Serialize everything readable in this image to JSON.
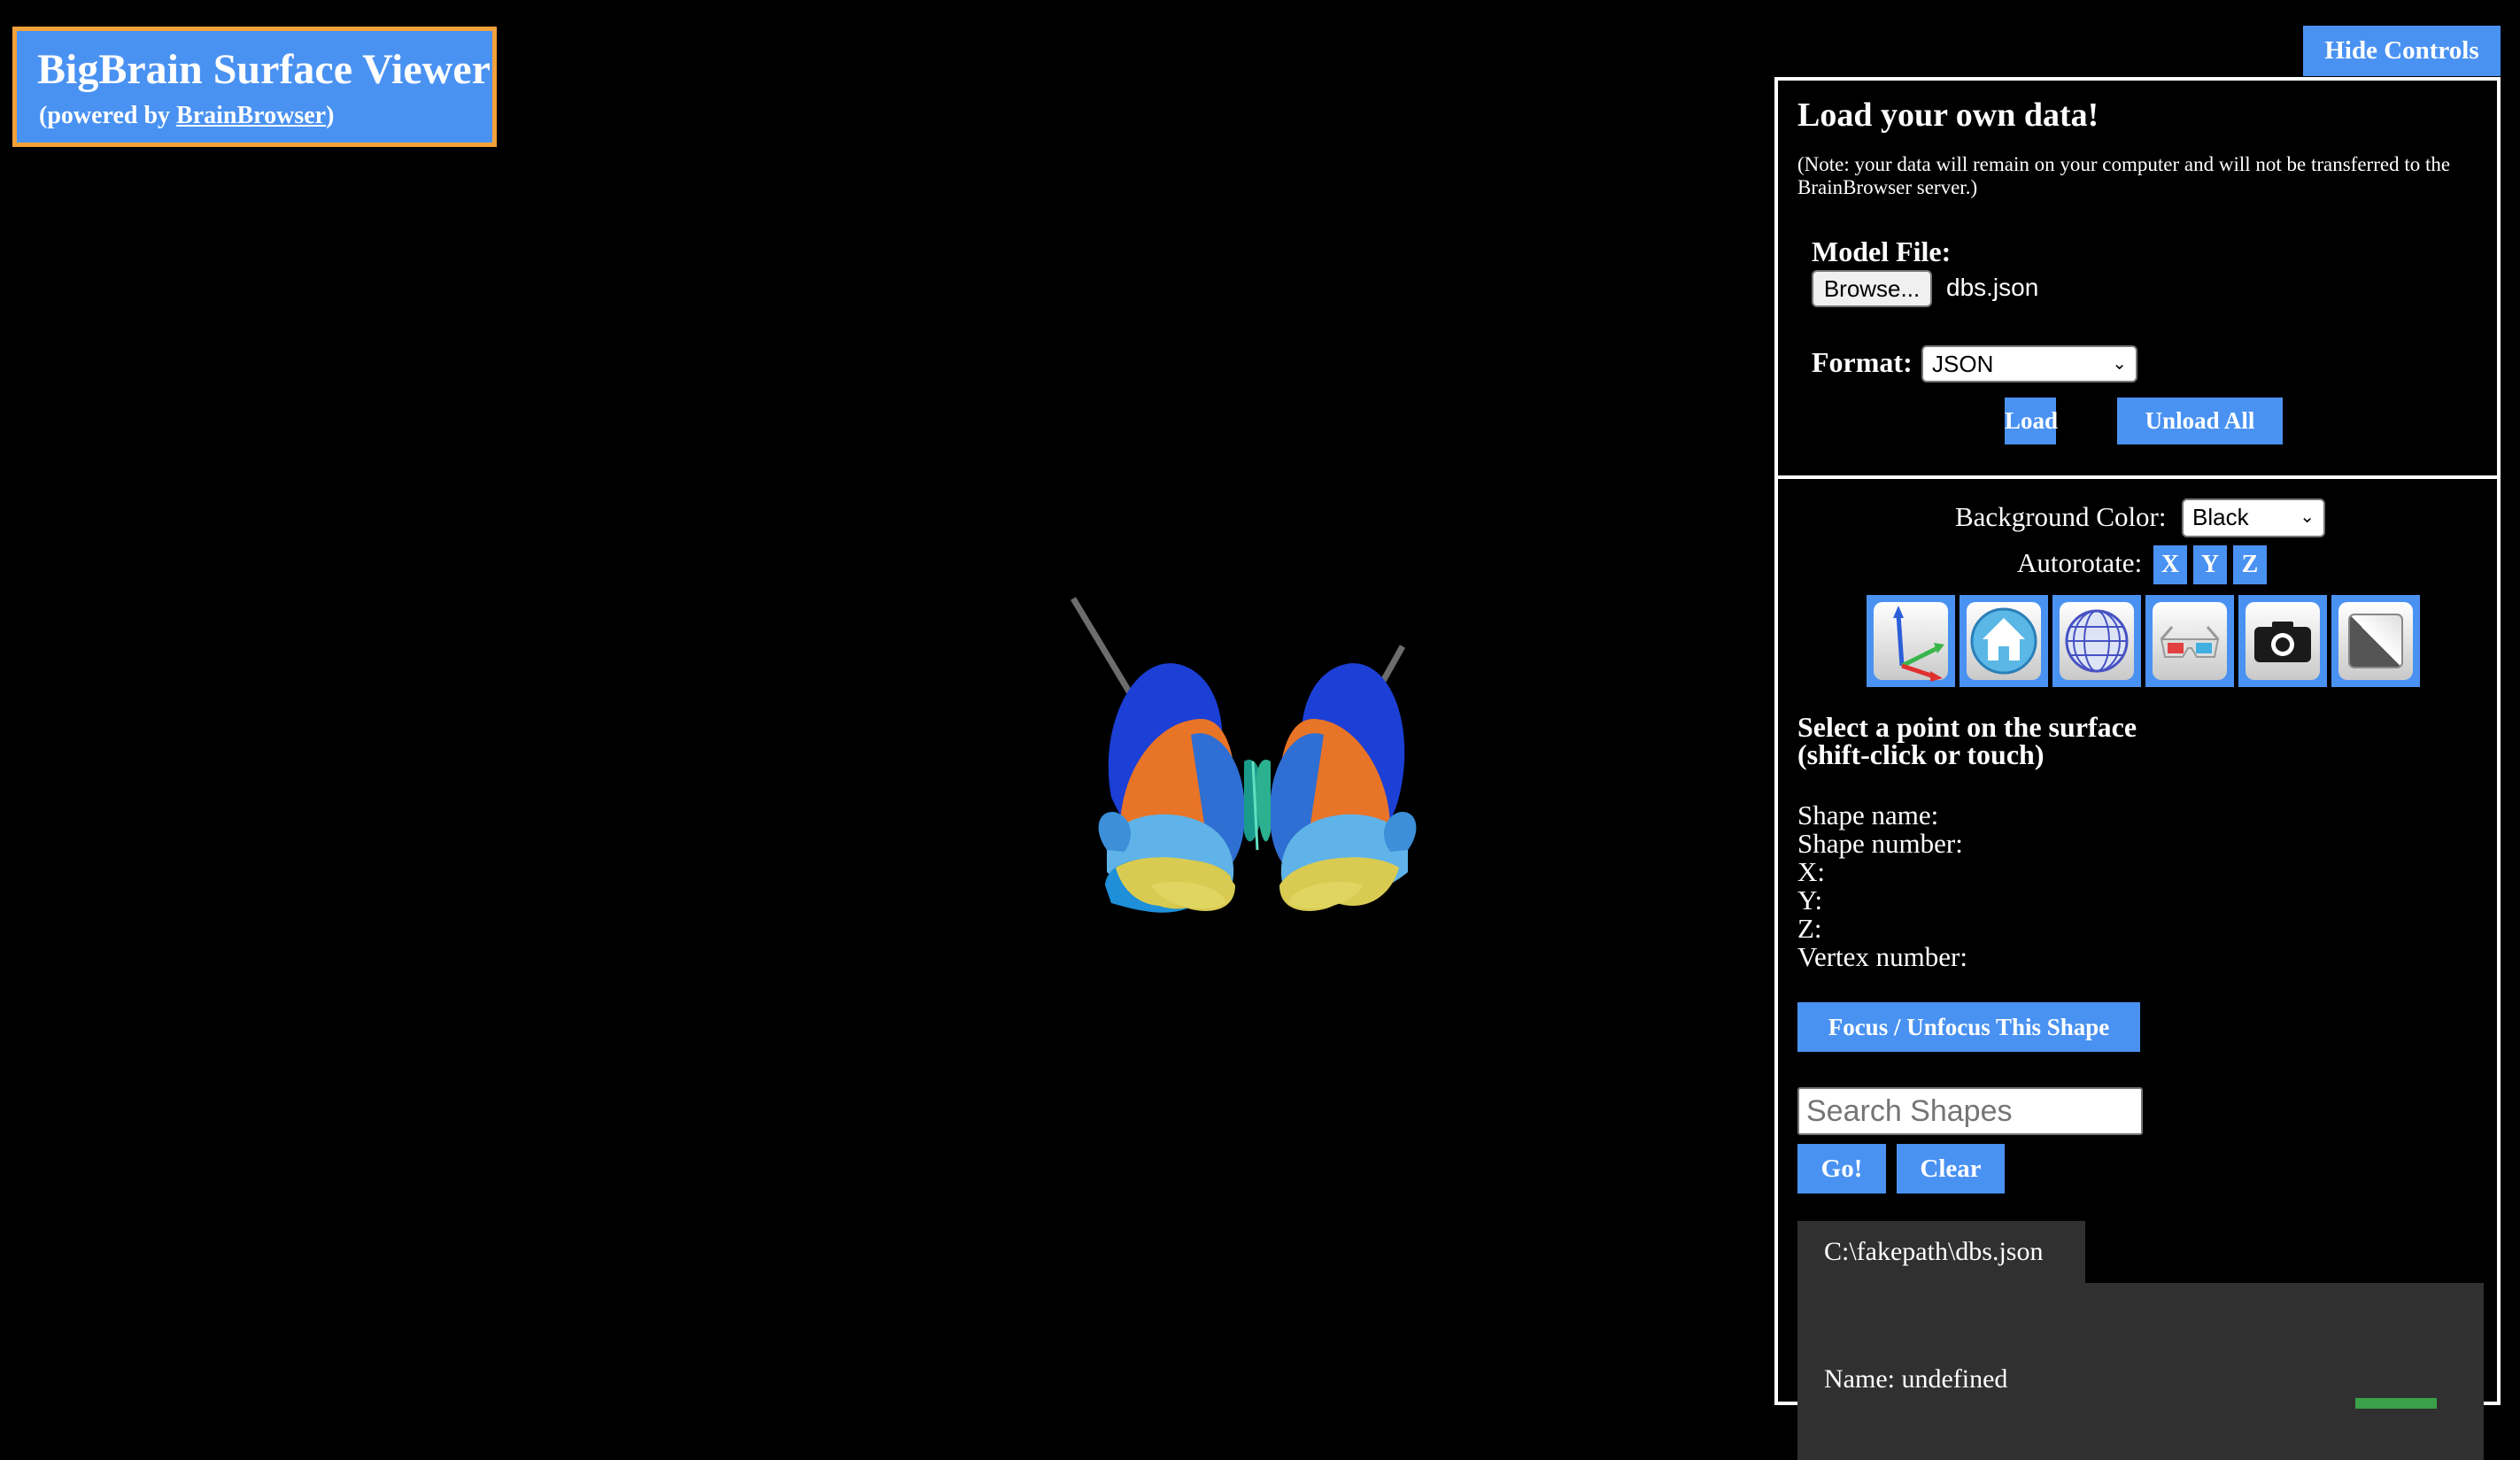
{
  "header": {
    "title": "BigBrain Surface Viewer",
    "powered_prefix": "(powered by ",
    "powered_link": "BrainBrowser",
    "powered_suffix": ")"
  },
  "hide_controls_label": "Hide Controls",
  "load_section": {
    "heading": "Load your own data!",
    "note": "(Note: your data will remain on your computer and will not be transferred to the BrainBrowser server.)",
    "model_file_label": "Model File:",
    "browse_label": "Browse...",
    "file_name": "dbs.json",
    "format_label": "Format:",
    "format_value": "JSON",
    "load_label": "Load",
    "unload_label": "Unload All"
  },
  "view_section": {
    "bg_label": "Background Color:",
    "bg_value": "Black",
    "autorotate_label": "Autorotate:",
    "axes": [
      "X",
      "Y",
      "Z"
    ],
    "tools": [
      "axes-icon",
      "home-icon",
      "wireframe-icon",
      "3d-glasses-icon",
      "camera-icon",
      "gradient-icon"
    ]
  },
  "pick_section": {
    "heading_line1": "Select a point on the surface",
    "heading_line2": "(shift-click or touch)",
    "shape_name": "Shape name:",
    "shape_number": "Shape number:",
    "x": "X:",
    "y": "Y:",
    "z": "Z:",
    "vertex": "Vertex number:",
    "focus_label": "Focus / Unfocus This Shape",
    "search_placeholder": "Search Shapes",
    "go_label": "Go!",
    "clear_label": "Clear"
  },
  "file_tab": {
    "label": "C:\\fakepath\\dbs.json",
    "name_line": "Name: undefined"
  },
  "colors": {
    "accent": "#4a92f2",
    "title_border": "#f3a13a",
    "background": "#000000"
  }
}
